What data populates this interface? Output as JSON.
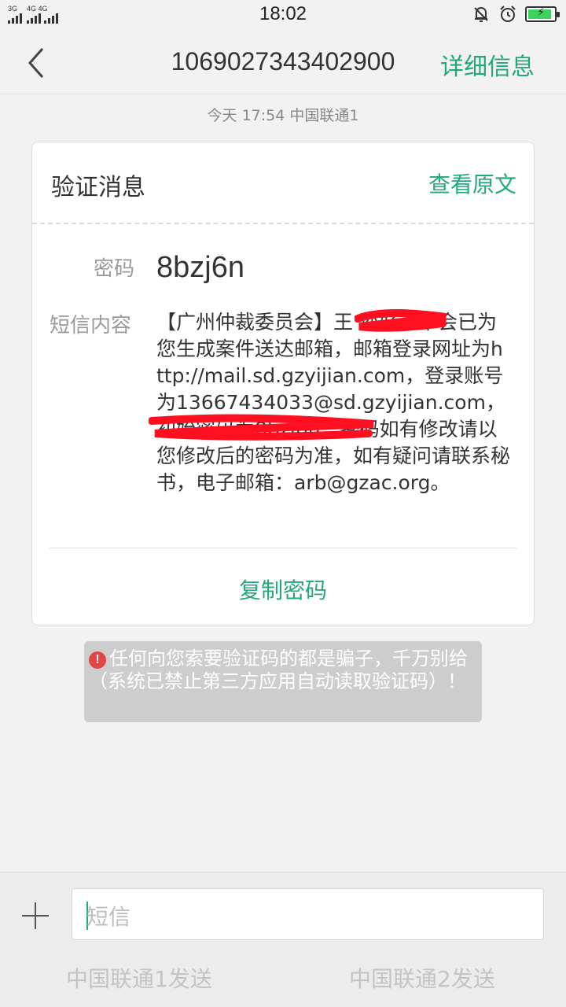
{
  "status_bar": {
    "network1": "3G",
    "network2": "4G 4G",
    "time": "18:02",
    "battery_level": 0.85,
    "battery_color": "#3bd35c"
  },
  "header": {
    "back_icon": "chevron-left-icon",
    "title": "1069027343402900",
    "detail_label": "详细信息"
  },
  "message_meta": {
    "date_line": "今天  17:54  中国联通1"
  },
  "card": {
    "title": "验证消息",
    "view_original": "查看原文",
    "password_label": "密码",
    "password_value": "8bzj6n",
    "sms_label": "短信内容",
    "sms_content": "【广州仲裁委员会】王 您好，本会已为您生成案件送达邮箱，邮箱登录网址为http://mail.sd.gzyijian.com，登录账号为13667434033@sd.gzyijian.com，初始密码为8bzj6n，密码如有修改请以您修改后的密码为准，如有疑问请联系秘书，电子邮箱：arb@gzac.org。",
    "copy_button": "复制密码",
    "accent_color": "#22a97a"
  },
  "warning": {
    "icon": "exclamation-icon",
    "text": "任何向您索要验证码的都是骗子，千万别给（系统已禁止第三方应用自动读取验证码）！"
  },
  "composer": {
    "add_icon": "plus-icon",
    "placeholder": "短信",
    "send_sim1": "中国联通1发送",
    "send_sim2": "中国联通2发送"
  }
}
